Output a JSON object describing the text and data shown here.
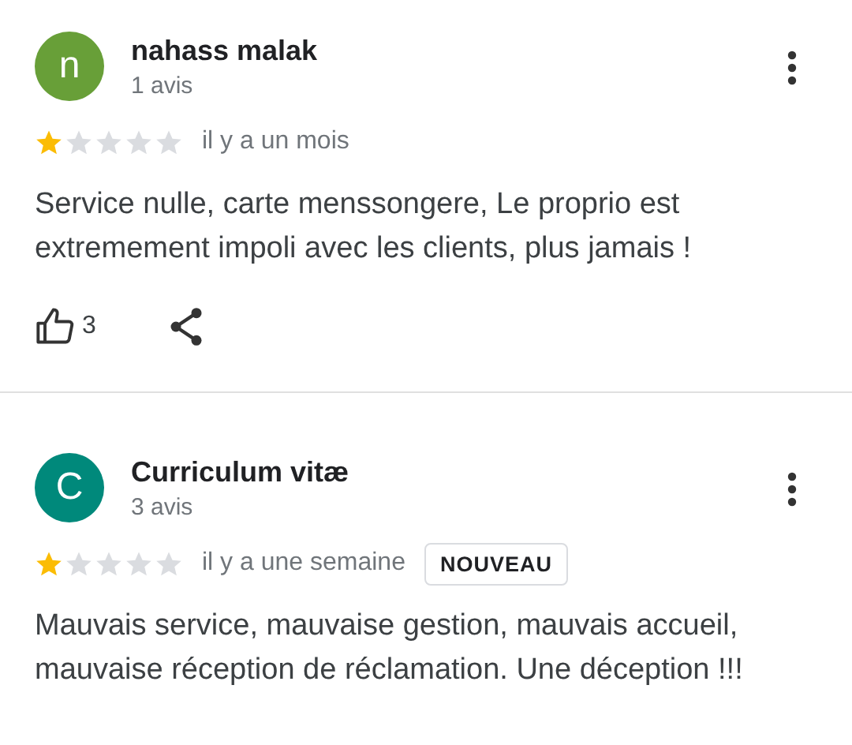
{
  "reviews": [
    {
      "initial": "n",
      "color": "#689f38",
      "name": "nahass malak",
      "count": "1 avis",
      "stars": 1,
      "time": "il y a un mois",
      "text": "Service nulle, carte menssongere, Le proprio est extremement impoli avec les clients, plus jamais !",
      "likes": "3"
    },
    {
      "initial": "C",
      "color": "#00897b",
      "name": "Curriculum vitæ",
      "count": "3 avis",
      "stars": 1,
      "time": "il y a une semaine",
      "badge": "NOUVEAU",
      "text": "Mauvais service, mauvaise gestion, mauvais accueil, mauvaise réception de réclamation. Une déception !!!"
    }
  ]
}
